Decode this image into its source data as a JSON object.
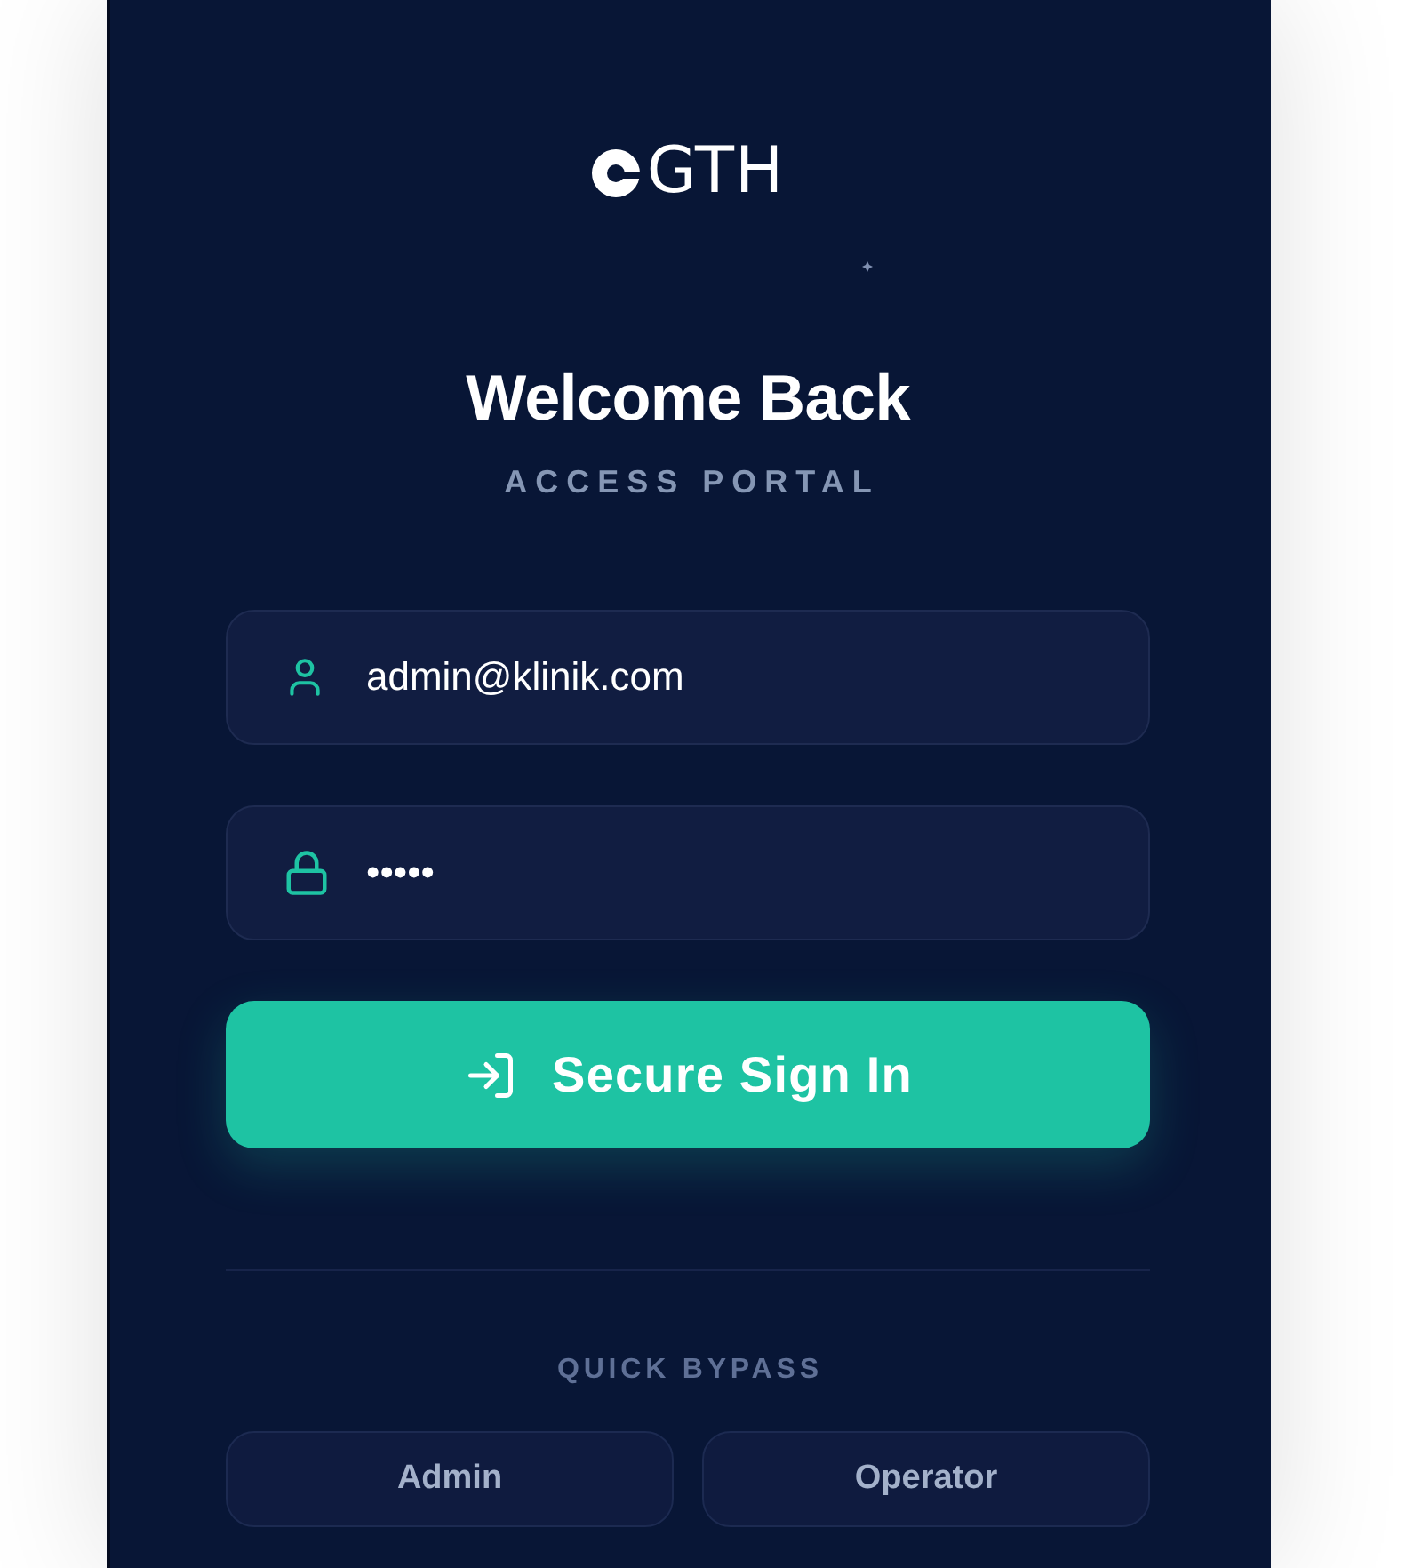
{
  "logo": {
    "text": "GTH"
  },
  "heading": {
    "title": "Welcome Back",
    "subtitle": "ACCESS PORTAL"
  },
  "form": {
    "fields": [
      {
        "kind": "email",
        "value": "admin@klinik.com"
      },
      {
        "kind": "password",
        "value": "•••••"
      }
    ],
    "submit": {
      "label": "Secure Sign In"
    }
  },
  "quick_bypass": {
    "title": "QUICK BYPASS",
    "options": [
      {
        "label": "Admin"
      },
      {
        "label": "Operator"
      }
    ]
  }
}
